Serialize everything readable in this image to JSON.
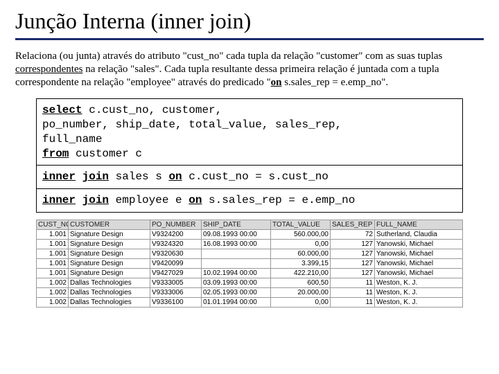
{
  "title": "Junção Interna (inner join)",
  "description_html": "Relaciona (ou junta) através do atributo \"cust_no\" cada tupla da relação \"customer\" com as suas tuplas <span class='u'>correspondentes</span> na relação \"sales\". Cada tupla resultante dessa primeira relação é juntada com a tupla correspondente na relação \"employee\" através do predicado \"<span class='bu'>on</span> s.sales_rep = e.emp_no\".",
  "code": {
    "block1": {
      "kw_select": "select",
      "select_cols": " c.cust_no, customer,",
      "select_cols2": "  po_number, ship_date, total_value, sales_rep,",
      "select_cols3": "  full_name",
      "kw_from": "from",
      "from_rest": " customer c"
    },
    "block2": {
      "kw_inner": "inner",
      "kw_join": "join",
      "mid1": " sales s ",
      "kw_on": "on",
      "rest1": " c.cust_no = s.cust_no"
    },
    "block3": {
      "kw_inner": "inner",
      "kw_join": "join",
      "mid2": " employee e ",
      "kw_on": "on",
      "rest2": " s.sales_rep = e.emp_no"
    }
  },
  "table": {
    "headers": [
      "CUST_NO",
      "CUSTOMER",
      "PO_NUMBER",
      "SHIP_DATE",
      "TOTAL_VALUE",
      "SALES_REP",
      "FULL_NAME"
    ],
    "rows": [
      [
        "1.001",
        "Signature Design",
        "V9324200",
        "09.08.1993 00:00",
        "560.000,00",
        "72",
        "Sutherland, Claudia"
      ],
      [
        "1.001",
        "Signature Design",
        "V9324320",
        "16.08.1993 00:00",
        "0,00",
        "127",
        "Yanowski, Michael"
      ],
      [
        "1.001",
        "Signature Design",
        "V9320630",
        "",
        "60.000,00",
        "127",
        "Yanowski, Michael"
      ],
      [
        "1.001",
        "Signature Design",
        "V9420099",
        "",
        "3.399,15",
        "127",
        "Yanowski, Michael"
      ],
      [
        "1.001",
        "Signature Design",
        "V9427029",
        "10.02.1994 00:00",
        "422.210,00",
        "127",
        "Yanowski, Michael"
      ],
      [
        "1.002",
        "Dallas Technologies",
        "V9333005",
        "03.09.1993 00:00",
        "600,50",
        "11",
        "Weston, K. J."
      ],
      [
        "1.002",
        "Dallas Technologies",
        "V9333006",
        "02.05.1993 00:00",
        "20.000,00",
        "11",
        "Weston, K. J."
      ],
      [
        "1.002",
        "Dallas Technologies",
        "V9336100",
        "01.01.1994 00:00",
        "0,00",
        "11",
        "Weston, K. J."
      ]
    ]
  }
}
